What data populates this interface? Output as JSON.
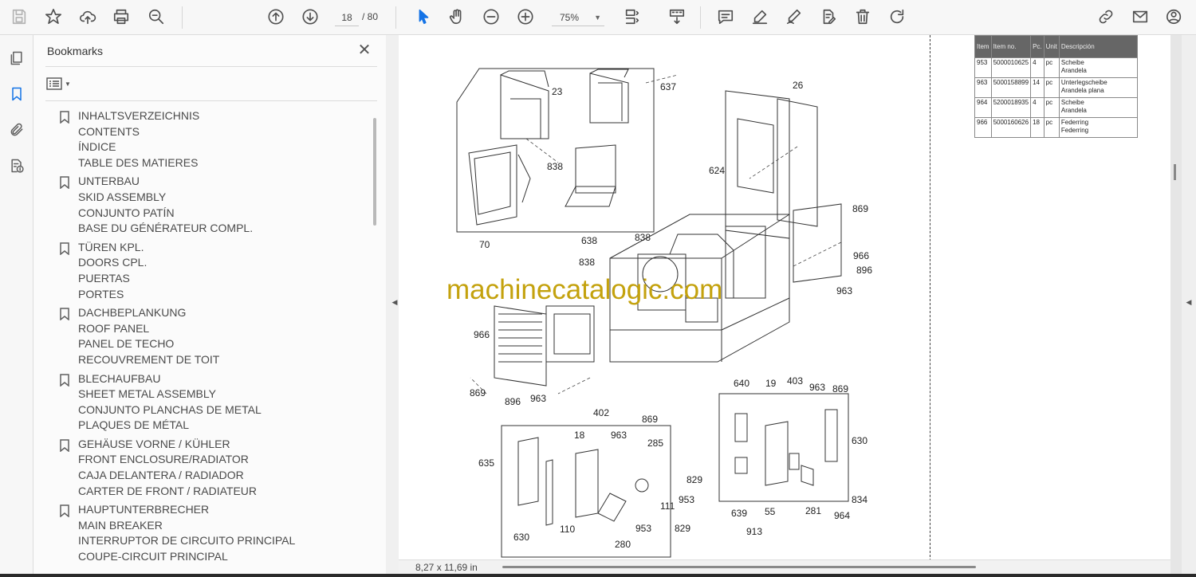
{
  "toolbar": {
    "page_current": "18",
    "page_total": "/ 80",
    "zoom": "75%",
    "icons": [
      "save-icon",
      "bookmark-star-icon",
      "upload-icon",
      "print-icon",
      "zoom-search-icon",
      "page-up-icon",
      "page-down-icon",
      "select-cursor-icon",
      "hand-icon",
      "zoom-out-icon",
      "zoom-in-icon",
      "page-fit-icon",
      "scroll-mode-icon",
      "comment-icon",
      "highlight-icon",
      "sign-icon",
      "stamp-icon",
      "delete-icon",
      "redo-icon",
      "share-link-icon",
      "mail-icon",
      "account-icon"
    ]
  },
  "bookmarks": {
    "title": "Bookmarks",
    "items": [
      {
        "lines": [
          "INHALTSVERZEICHNIS",
          "CONTENTS",
          "ÍNDICE",
          "TABLE DES MATIERES"
        ]
      },
      {
        "lines": [
          "UNTERBAU",
          "SKID ASSEMBLY",
          "CONJUNTO PATÍN",
          "BASE DU GÉNÉRATEUR COMPL."
        ]
      },
      {
        "lines": [
          "TÜREN KPL.",
          "DOORS CPL.",
          "PUERTAS",
          "PORTES"
        ]
      },
      {
        "lines": [
          "DACHBEPLANKUNG",
          "ROOF PANEL",
          "PANEL DE TECHO",
          "RECOUVREMENT DE TOIT"
        ]
      },
      {
        "lines": [
          "BLECHAUFBAU",
          "SHEET METAL ASSEMBLY",
          "CONJUNTO PLANCHAS DE METAL",
          "PLAQUES DE MÉTAL"
        ]
      },
      {
        "lines": [
          "GEHÄUSE VORNE / KÜHLER",
          "FRONT ENCLOSURE/RADIATOR",
          "CAJA DELANTERA / RADIADOR",
          "CARTER DE FRONT / RADIATEUR"
        ]
      },
      {
        "lines": [
          "HAUPTUNTERBRECHER",
          "MAIN BREAKER",
          "INTERRUPTOR DE CIRCUITO PRINCIPAL",
          "COUPE-CIRCUIT PRINCIPAL"
        ]
      }
    ]
  },
  "document": {
    "watermark": "machinecatalogic.com",
    "page_size": "8,27 x 11,69 in",
    "table": {
      "headers": [
        "Item",
        "Item no.",
        "Pc.",
        "Unit",
        "Descripción"
      ],
      "rows": [
        [
          "953",
          "5000010625",
          "4",
          "pc",
          "Scheibe",
          "Arandela"
        ],
        [
          "963",
          "5000158899",
          "14",
          "pc",
          "Unterlegscheibe",
          "Arandela plana"
        ],
        [
          "964",
          "5200018935",
          "4",
          "pc",
          "Scheibe",
          "Arandela"
        ],
        [
          "966",
          "5000160626",
          "18",
          "pc",
          "Federring",
          "Federring"
        ]
      ]
    },
    "callouts": [
      "23",
      "637",
      "26",
      "838",
      "624",
      "70",
      "638",
      "838",
      "869",
      "838",
      "966",
      "896",
      "963",
      "966",
      "869",
      "896",
      "963",
      "640",
      "19",
      "403",
      "963",
      "869",
      "630",
      "639",
      "55",
      "281",
      "834",
      "913",
      "964",
      "402",
      "869",
      "18",
      "963",
      "285",
      "635",
      "829",
      "953",
      "111",
      "953",
      "829",
      "110",
      "630",
      "280"
    ]
  }
}
